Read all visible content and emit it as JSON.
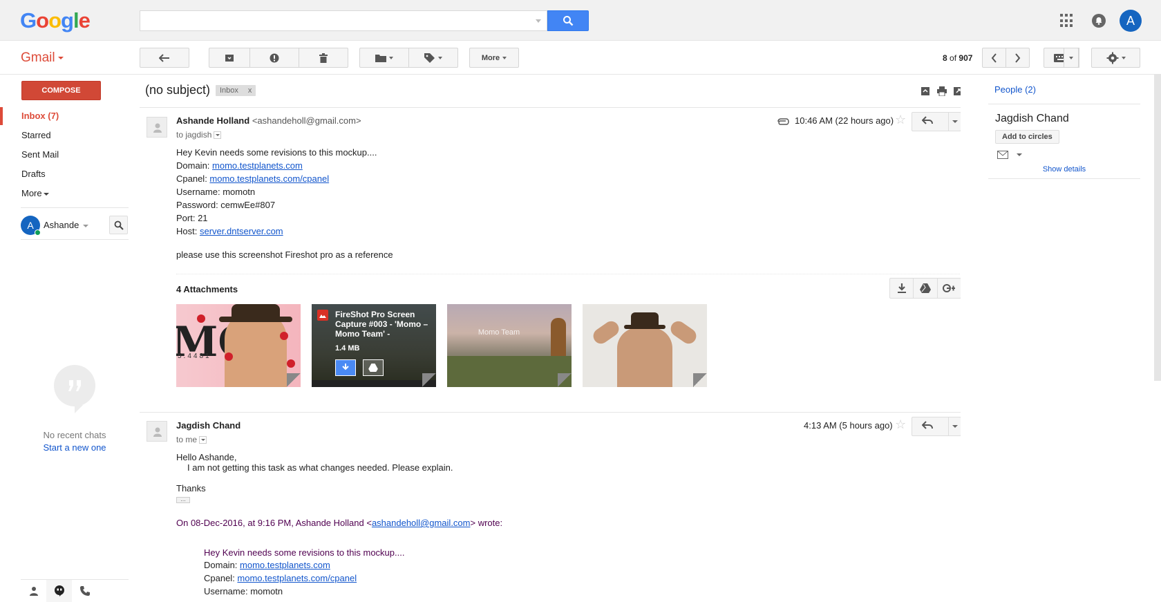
{
  "header": {
    "logo": "Google",
    "search_placeholder": "",
    "avatar_letter": "A"
  },
  "toolbar": {
    "app_label": "Gmail",
    "more_label": "More",
    "pager_position": "8",
    "pager_of": "of",
    "pager_total": "907"
  },
  "sidebar": {
    "compose_label": "COMPOSE",
    "items": [
      {
        "label": "Inbox (7)",
        "active": true
      },
      {
        "label": "Starred"
      },
      {
        "label": "Sent Mail"
      },
      {
        "label": "Drafts"
      },
      {
        "label": "More"
      }
    ],
    "hangouts_user": "Ashande",
    "hangouts_avatar": "A",
    "no_chats": "No recent chats",
    "start_new": "Start a new one"
  },
  "thread": {
    "subject": "(no subject)",
    "label_chip": "Inbox",
    "label_remove": "x",
    "messages": [
      {
        "sender_name": "Ashande Holland",
        "sender_email": "<ashandeholl@gmail.com>",
        "to": "to jagdish",
        "time": "10:46 AM (22 hours ago)",
        "lines": [
          {
            "text": "Hey Kevin needs some revisions to this mockup...."
          },
          {
            "label": "Domain: ",
            "link": "momo.testplanets.com"
          },
          {
            "label": "Cpanel: ",
            "link": "momo.testplanets.com/cpanel"
          },
          {
            "text": "Username: momotn"
          },
          {
            "text": "Password: cemwEe#807"
          },
          {
            "text": "Port: 21"
          },
          {
            "label": "Host: ",
            "link": "server.dntserver.com"
          },
          {
            "text": "please use this screenshot Fireshot pro as a reference"
          }
        ],
        "attachments_title": "4 Attachments",
        "attachments": [
          {
            "kind": "image",
            "caption_big": "MO",
            "caption_small": "5.4481"
          },
          {
            "kind": "file",
            "title": "FireShot Pro Screen Capture #003 - 'Momo – Momo Team' -",
            "size": "1.4 MB"
          },
          {
            "kind": "image",
            "caption": "Momo Team"
          },
          {
            "kind": "image"
          }
        ]
      },
      {
        "sender_name": "Jagdish Chand",
        "to": "to me",
        "time": "4:13 AM (5 hours ago)",
        "lines": [
          {
            "text": "Hello Ashande,"
          },
          {
            "text": "I am not getting this task as what changes needed. Please explain."
          },
          {
            "text": "Thanks"
          }
        ],
        "trimmed": "...",
        "quote_header_pre": "On 08-Dec-2016, at 9:16 PM, Ashande Holland <",
        "quote_header_link": "ashandeholl@gmail.com",
        "quote_header_post": "> wrote:",
        "quoted_lines": [
          {
            "text": "Hey Kevin needs some revisions to this mockup...."
          },
          {
            "label": "Domain: ",
            "link": "momo.testplanets.com"
          },
          {
            "label": "Cpanel: ",
            "link": "momo.testplanets.com/cpanel"
          },
          {
            "text": "Username: momotn"
          }
        ]
      }
    ]
  },
  "people": {
    "title": "People (2)",
    "person_name": "Jagdish Chand",
    "add_circles": "Add to circles",
    "show_details": "Show details"
  },
  "colors": {
    "gmail_red": "#dd4b39",
    "search_blue": "#4285f4",
    "link": "#1155cc",
    "quoted": "#500050"
  }
}
